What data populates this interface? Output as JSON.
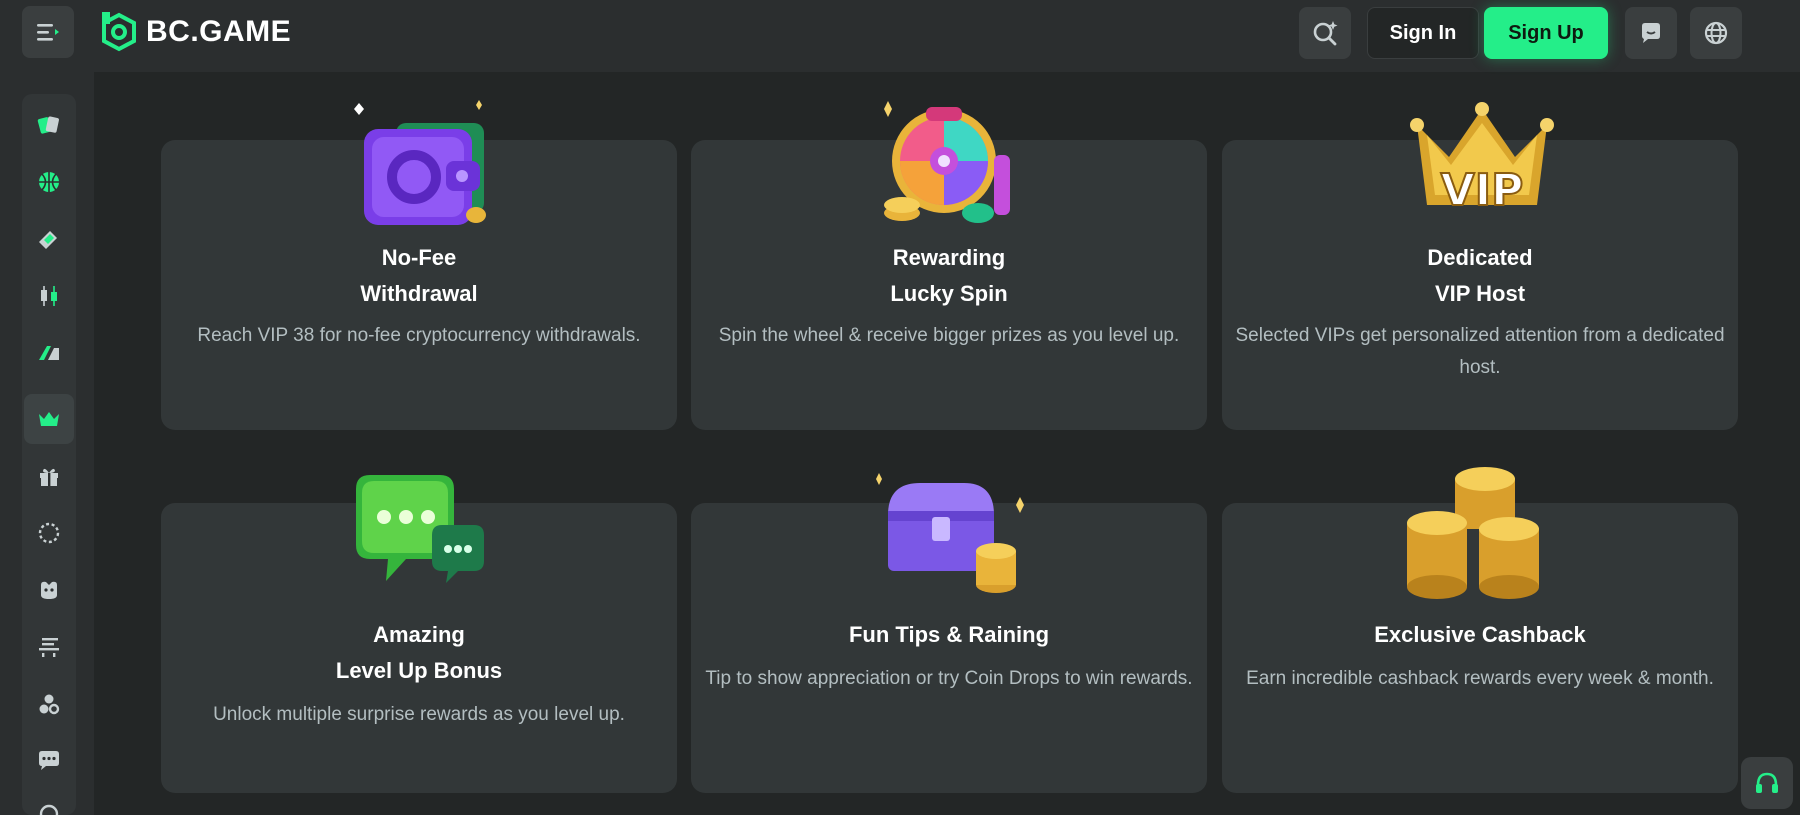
{
  "header": {
    "logo_text": "BC.GAME",
    "signin_label": "Sign In",
    "signup_label": "Sign Up",
    "icons": [
      "menu-icon",
      "search-icon",
      "chat-icon",
      "globe-icon"
    ]
  },
  "sidebar": {
    "items": [
      {
        "icon": "casino-cards-icon"
      },
      {
        "icon": "basketball-icon"
      },
      {
        "icon": "lottery-ticket-icon"
      },
      {
        "icon": "trading-candles-icon"
      },
      {
        "icon": "racing-icon"
      },
      {
        "icon": "vip-crown-icon",
        "active": true
      },
      {
        "icon": "gift-icon"
      },
      {
        "icon": "spin-wheel-icon"
      },
      {
        "icon": "piggy-icon"
      },
      {
        "icon": "sponsorship-icon"
      },
      {
        "icon": "community-icon"
      },
      {
        "icon": "chat-bubble-icon"
      },
      {
        "icon": "more-icon"
      }
    ]
  },
  "cards": [
    {
      "title1": "No-Fee",
      "title2": "Withdrawal",
      "desc": "Reach VIP 38 for no-fee cryptocurrency withdrawals.",
      "art": "wallet-icon"
    },
    {
      "title1": "Rewarding",
      "title2": "Lucky Spin",
      "desc": "Spin the wheel & receive bigger prizes as you level up.",
      "art": "lucky-wheel-icon"
    },
    {
      "title1": "Dedicated",
      "title2": "VIP Host",
      "desc": "Selected VIPs get personalized attention from a dedicated host.",
      "art": "vip-crown-art-icon"
    },
    {
      "title1": "Amazing",
      "title2": "Level Up Bonus",
      "desc": "Unlock multiple surprise rewards as you level up.",
      "art": "chat-bubbles-art-icon"
    },
    {
      "title1": "Fun Tips & Raining",
      "title2": "",
      "desc": "Tip to show appreciation or try Coin Drops to win rewards.",
      "art": "treasure-chest-icon"
    },
    {
      "title1": "Exclusive Cashback",
      "title2": "",
      "desc": "Earn incredible cashback rewards every week & month.",
      "art": "coin-stacks-icon"
    }
  ],
  "support": {
    "icon": "headset-icon"
  },
  "colors": {
    "accent": "#24ee89",
    "background": "#232626",
    "card": "#323738",
    "desc_text": "#b3bec1"
  }
}
